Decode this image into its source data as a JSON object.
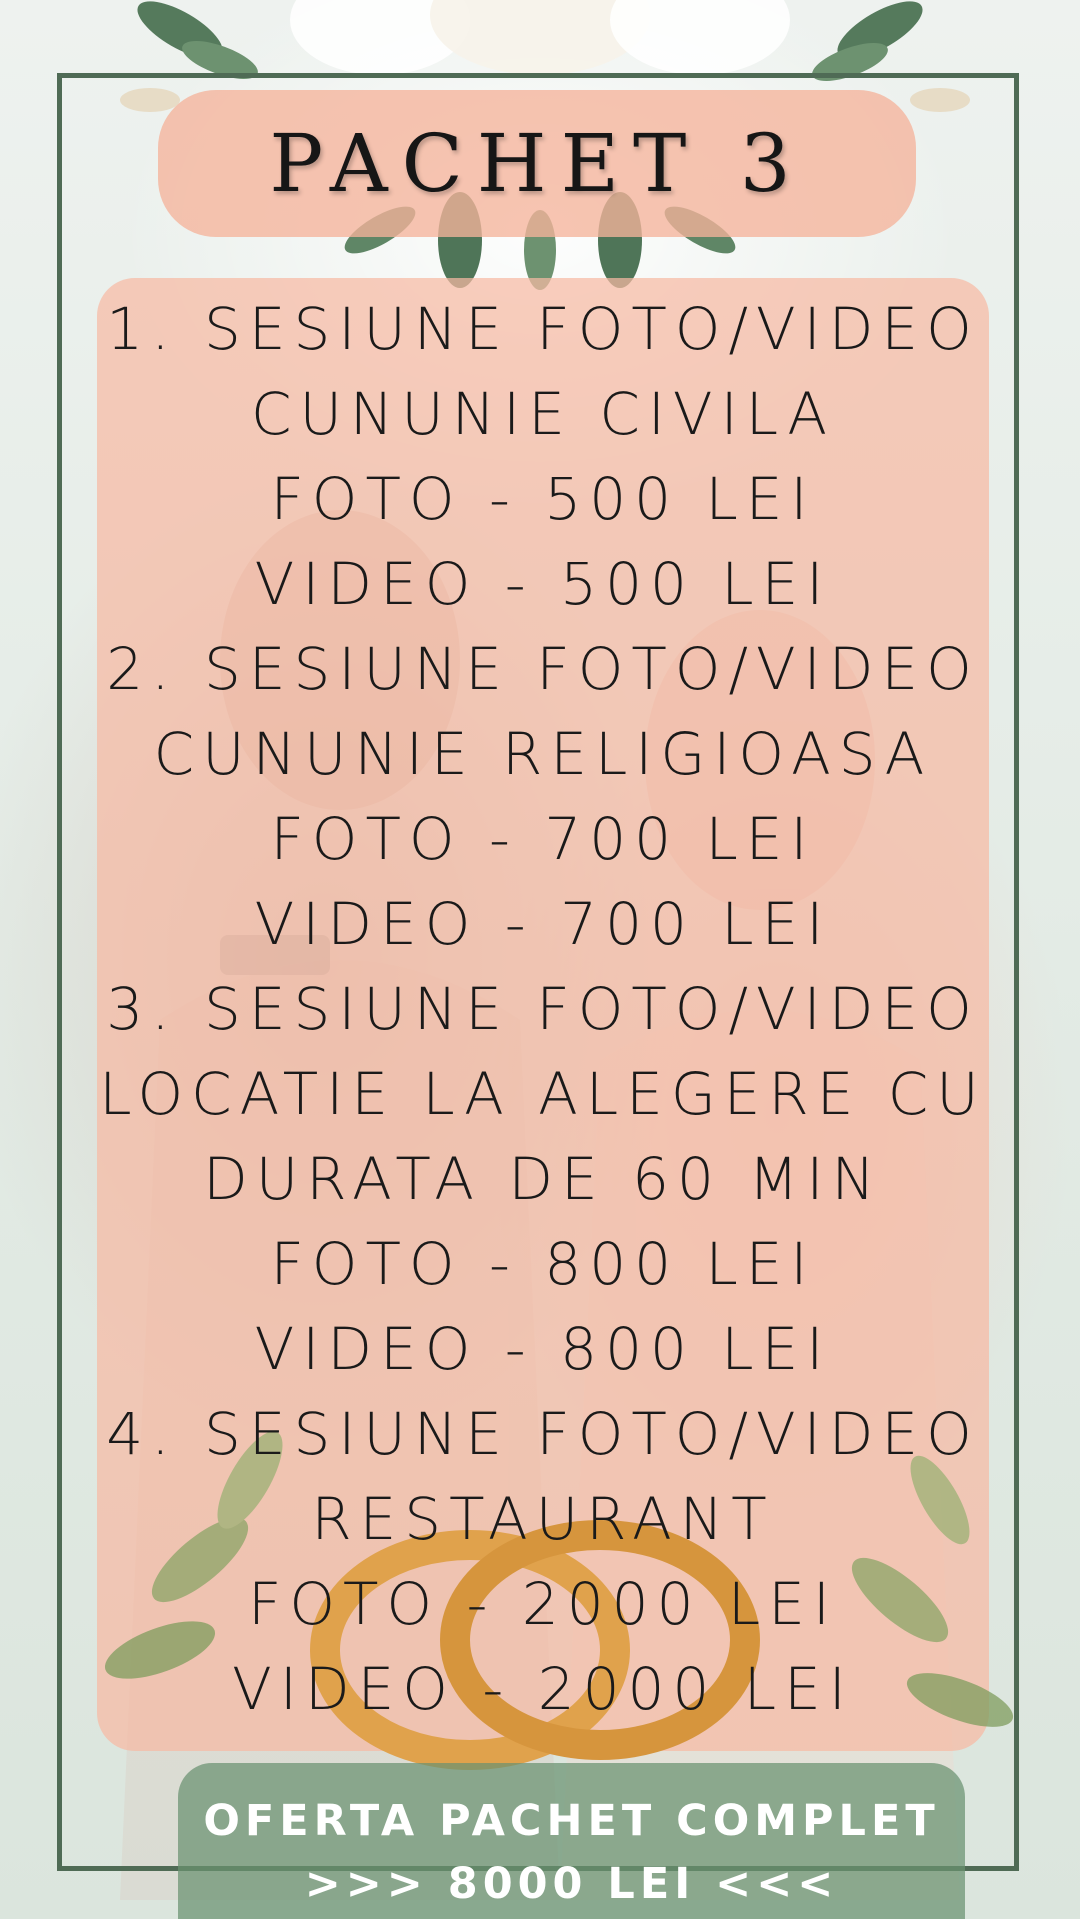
{
  "title": "PACHET 3",
  "lines": [
    "1. SESIUNE FOTO/VIDEO",
    "CUNUNIE CIVILA",
    "FOTO - 500 LEI",
    "VIDEO - 500 LEI",
    "2. SESIUNE FOTO/VIDEO",
    "CUNUNIE RELIGIOASA",
    "FOTO - 700 LEI",
    "VIDEO - 700 LEI",
    "3. SESIUNE FOTO/VIDEO",
    "LOCATIE LA ALEGERE CU",
    "DURATA DE 60 MIN",
    "FOTO - 800 LEI",
    "VIDEO - 800 LEI",
    "4. SESIUNE FOTO/VIDEO",
    "RESTAURANT",
    "FOTO - 2000 LEI",
    "VIDEO - 2000 LEI"
  ],
  "footer": {
    "line1": "OFERTA PACHET COMPLET",
    "line2": ">>> 8000 LEI <<<"
  },
  "colors": {
    "frame": "#4f6b55",
    "panel": "#f6baa4",
    "footer": "#699170",
    "rings": "#e0a24c"
  },
  "icons": [
    "leaf-garland-icon",
    "wedding-rings-icon",
    "flower-bouquet-icon"
  ]
}
